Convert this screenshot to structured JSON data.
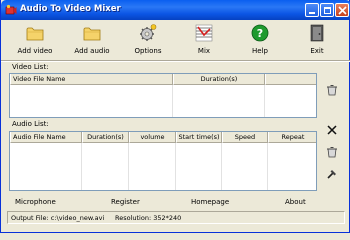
{
  "window": {
    "title": "Audio To Video Mixer",
    "icons": {
      "app": "audio-video-icon",
      "minimize": "minimize-icon",
      "maximize": "maximize-icon",
      "close": "close-icon"
    }
  },
  "toolbar": {
    "add_video": "Add video",
    "add_audio": "Add audio",
    "options": "Options",
    "mix": "Mix",
    "help": "Help",
    "exit": "Exit"
  },
  "video_list": {
    "label": "Video List:",
    "columns": [
      "Video File Name",
      "Duration(s)"
    ]
  },
  "audio_list": {
    "label": "Audio List:",
    "columns": [
      "Audio File Name",
      "Duration(s)",
      "volume",
      "Start time(s)",
      "Speed",
      "Repeat"
    ]
  },
  "side_buttons": [
    "clear-video-icon",
    "delete-audio-icon",
    "clear-audio-icon",
    "tools-icon"
  ],
  "links": {
    "microphone": "Microphone",
    "register": "Register",
    "homepage": "Homepage",
    "about": "About"
  },
  "status": {
    "output_file": "Output File:  c:\\video_new.avi",
    "resolution": "Resolution:  352*240"
  },
  "colors": {
    "title_bar": "#0a5ff0",
    "window_bg": "#ece9d8",
    "grid_border": "#7f9db9"
  }
}
